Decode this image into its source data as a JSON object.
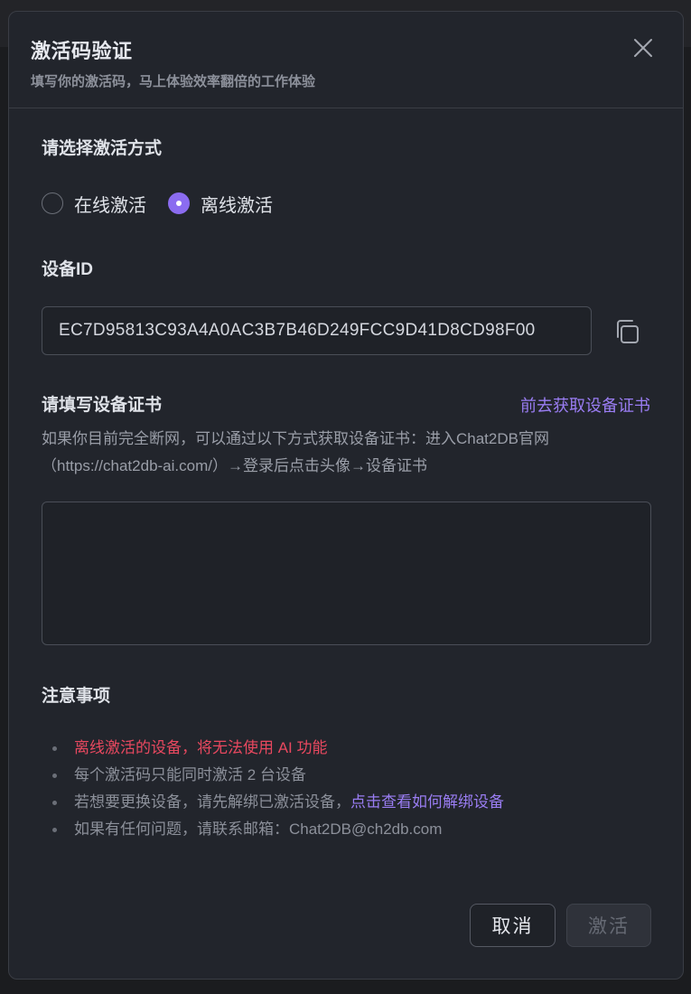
{
  "modal": {
    "title": "激活码验证",
    "subtitle": "填写你的激活码，马上体验效率翻倍的工作体验"
  },
  "activation_method": {
    "label": "请选择激活方式",
    "options": [
      {
        "label": "在线激活",
        "checked": false
      },
      {
        "label": "离线激活",
        "checked": true
      }
    ]
  },
  "device_id": {
    "label": "设备ID",
    "value": "EC7D95813C93A4A0AC3B7B46D249FCC9D41D8CD98F00"
  },
  "certificate": {
    "label": "请填写设备证书",
    "link": "前去获取设备证书",
    "description": "如果你目前完全断网，可以通过以下方式获取设备证书：进入Chat2DB官网（https://chat2db-ai.com/）→登录后点击头像→设备证书",
    "value": ""
  },
  "notes": {
    "label": "注意事项",
    "items": [
      "离线激活的设备，将无法使用 AI 功能",
      "每个激活码只能同时激活 2 台设备",
      "若想要更换设备，请先解绑已激活设备，",
      "如果有任何问题，请联系邮箱：Chat2DB@ch2db.com"
    ],
    "unbind_link": "点击查看如何解绑设备"
  },
  "buttons": {
    "cancel": "取消",
    "activate": "激活"
  },
  "colors": {
    "accent": "#8b6cf0",
    "warning": "#e8485f",
    "modal_bg": "#22252c"
  },
  "icons": {
    "close": "close-icon",
    "copy": "copy-icon"
  }
}
